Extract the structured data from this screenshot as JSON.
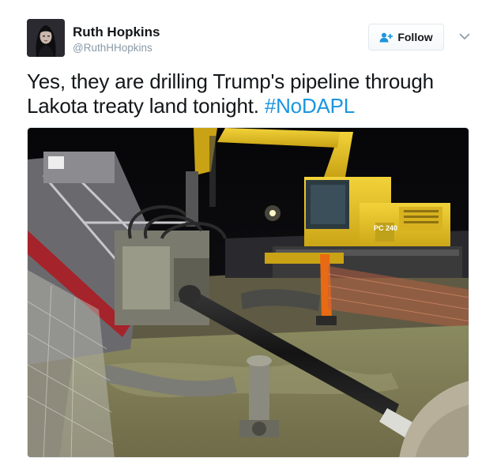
{
  "author": {
    "name": "Ruth Hopkins",
    "handle": "@RuthHHopkins"
  },
  "follow_button": {
    "label": "Follow",
    "icon": "add-user-icon",
    "accent": "#1b95e0"
  },
  "menu": {
    "icon": "chevron-down-icon"
  },
  "tweet": {
    "text": "Yes, they are drilling Trump's pipeline through Lakota treaty land tonight.",
    "hashtag": "#NoDAPL",
    "hashtag_color": "#1b95e0"
  },
  "media": {
    "type": "photo",
    "machine_labels": {
      "excavator_model": "PC 240"
    }
  },
  "colors": {
    "text": "#14171a",
    "secondary": "#8899a6"
  }
}
